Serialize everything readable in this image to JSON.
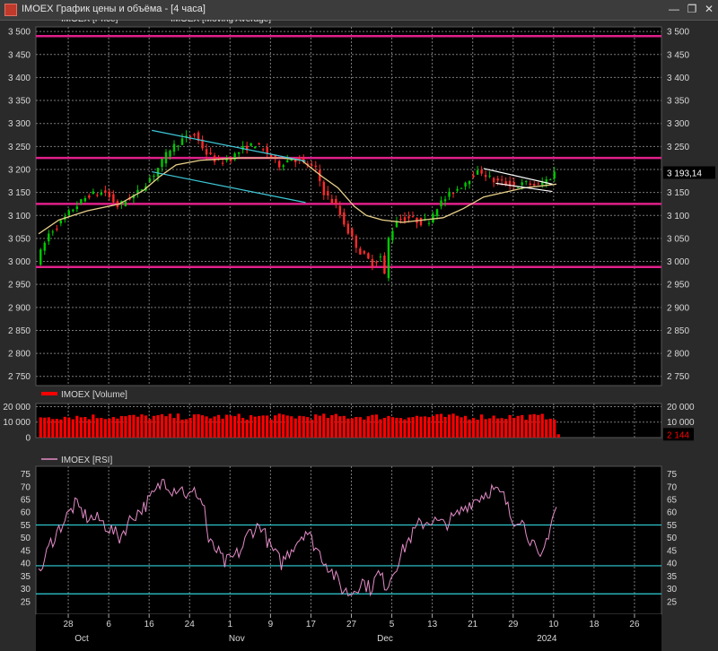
{
  "window": {
    "title": "IMOEX График цены и объёма - [4 часа]",
    "minimize_glyph": "—",
    "restore_glyph": "❐",
    "close_glyph": "✕"
  },
  "colors": {
    "background": "#2a2a2a",
    "plot_background": "#000000",
    "grid": "#7a7a7a",
    "bull_candle": "#00c800",
    "bear_candle": "#ff2a2a",
    "moving_average": "#e8d08a",
    "level_line": "#e0208a",
    "channel_line": "#3ec8d8",
    "flag_line": "#ffffff",
    "volume": "#ff0000",
    "rsi_line": "#e48cc8",
    "rsi_level": "#30d0d8",
    "last_price_label": "#000000"
  },
  "chart_data": [
    {
      "type": "candlestick",
      "panel": "price",
      "series": [
        {
          "name": "IMOEX [Price]",
          "legend_icon": "white-line"
        },
        {
          "name": "IMOEX [Moving Average]",
          "legend_icon": "tan-line"
        }
      ],
      "ylim": [
        2730,
        3510
      ],
      "y_ticks": [
        "3 500",
        "3 450",
        "3 400",
        "3 350",
        "3 300",
        "3 250",
        "3 200",
        "3 150",
        "3 100",
        "3 050",
        "3 000",
        "2 950",
        "2 900",
        "2 850",
        "2 800",
        "2 750"
      ],
      "y_tick_values": [
        3500,
        3450,
        3400,
        3350,
        3300,
        3250,
        3200,
        3150,
        3100,
        3050,
        3000,
        2950,
        2900,
        2850,
        2800,
        2750
      ],
      "last_price_label": "3 193,14",
      "last_price": 3193.14,
      "horizontal_levels": [
        3490,
        3225,
        3125,
        2988
      ],
      "price_path": [
        [
          0,
          3000
        ],
        [
          3,
          3060
        ],
        [
          6,
          3085
        ],
        [
          9,
          3115
        ],
        [
          13,
          3145
        ],
        [
          17,
          3150
        ],
        [
          20,
          3120
        ],
        [
          25,
          3150
        ],
        [
          29,
          3190
        ],
        [
          33,
          3245
        ],
        [
          36,
          3265
        ],
        [
          39,
          3275
        ],
        [
          42,
          3235
        ],
        [
          45,
          3215
        ],
        [
          48,
          3225
        ],
        [
          51,
          3245
        ],
        [
          54,
          3255
        ],
        [
          57,
          3235
        ],
        [
          60,
          3210
        ],
        [
          63,
          3225
        ],
        [
          66,
          3215
        ],
        [
          69,
          3200
        ],
        [
          71,
          3150
        ],
        [
          74,
          3120
        ],
        [
          77,
          3065
        ],
        [
          80,
          3020
        ],
        [
          83,
          2995
        ],
        [
          85,
          3010
        ],
        [
          86,
          2970
        ],
        [
          87,
          3050
        ],
        [
          89,
          3090
        ],
        [
          92,
          3095
        ],
        [
          95,
          3085
        ],
        [
          97,
          3090
        ],
        [
          99,
          3120
        ],
        [
          102,
          3145
        ],
        [
          105,
          3165
        ],
        [
          108,
          3190
        ],
        [
          110,
          3195
        ],
        [
          113,
          3175
        ],
        [
          116,
          3170
        ],
        [
          119,
          3165
        ],
        [
          121,
          3170
        ],
        [
          124,
          3165
        ],
        [
          127,
          3183
        ],
        [
          128,
          3193.14
        ]
      ],
      "ma_path": [
        [
          0,
          3060
        ],
        [
          5,
          3090
        ],
        [
          12,
          3110
        ],
        [
          20,
          3125
        ],
        [
          26,
          3155
        ],
        [
          30,
          3185
        ],
        [
          34,
          3210
        ],
        [
          40,
          3220
        ],
        [
          50,
          3225
        ],
        [
          60,
          3225
        ],
        [
          65,
          3220
        ],
        [
          70,
          3185
        ],
        [
          74,
          3160
        ],
        [
          78,
          3120
        ],
        [
          81,
          3100
        ],
        [
          85,
          3090
        ],
        [
          90,
          3085
        ],
        [
          95,
          3090
        ],
        [
          100,
          3095
        ],
        [
          105,
          3115
        ],
        [
          110,
          3140
        ],
        [
          115,
          3150
        ],
        [
          120,
          3160
        ],
        [
          125,
          3165
        ],
        [
          128,
          3168
        ]
      ],
      "trend_lines": [
        {
          "name": "channel-upper",
          "from": [
            28,
            3285
          ],
          "to": [
            66,
            3218
          ]
        },
        {
          "name": "channel-lower",
          "from": [
            28,
            3195
          ],
          "to": [
            66,
            3128
          ]
        },
        {
          "name": "flag-upper",
          "from": [
            110,
            3202
          ],
          "to": [
            127,
            3168
          ]
        },
        {
          "name": "flag-lower",
          "from": [
            113,
            3170
          ],
          "to": [
            127,
            3152
          ]
        }
      ]
    },
    {
      "type": "bar",
      "panel": "volume",
      "series": [
        {
          "name": "IMOEX [Volume]",
          "legend_icon": "red-bar"
        }
      ],
      "ylim": [
        0,
        22000
      ],
      "y_ticks_left": [
        "20 000",
        "10 000",
        "0"
      ],
      "y_ticks_right": [
        "20 000",
        "10 000"
      ],
      "y_tick_values": [
        20000,
        10000,
        0
      ],
      "last_value_label": "2 144",
      "typical_value": 13500,
      "last_value": 2144
    },
    {
      "type": "line",
      "panel": "rsi",
      "series": [
        {
          "name": "IMOEX [RSI]",
          "legend_icon": "pink-line"
        }
      ],
      "ylim": [
        20,
        78
      ],
      "y_ticks": [
        "75",
        "70",
        "65",
        "60",
        "55",
        "50",
        "45",
        "40",
        "35",
        "30",
        "25"
      ],
      "y_tick_values": [
        75,
        70,
        65,
        60,
        55,
        50,
        45,
        40,
        35,
        30,
        25
      ],
      "levels": [
        55,
        39,
        28
      ],
      "rsi_path": [
        [
          0,
          35
        ],
        [
          3,
          48
        ],
        [
          6,
          56
        ],
        [
          9,
          63
        ],
        [
          12,
          58
        ],
        [
          15,
          57
        ],
        [
          18,
          53
        ],
        [
          20,
          50
        ],
        [
          23,
          58
        ],
        [
          26,
          62
        ],
        [
          29,
          68
        ],
        [
          31,
          73
        ],
        [
          33,
          69
        ],
        [
          35,
          70
        ],
        [
          37,
          66
        ],
        [
          39,
          68
        ],
        [
          41,
          62
        ],
        [
          42,
          48
        ],
        [
          44,
          45
        ],
        [
          46,
          40
        ],
        [
          48,
          42
        ],
        [
          50,
          45
        ],
        [
          52,
          52
        ],
        [
          55,
          55
        ],
        [
          57,
          47
        ],
        [
          60,
          40
        ],
        [
          63,
          47
        ],
        [
          66,
          53
        ],
        [
          69,
          45
        ],
        [
          72,
          38
        ],
        [
          75,
          30
        ],
        [
          77,
          28
        ],
        [
          80,
          33
        ],
        [
          82,
          30
        ],
        [
          84,
          36
        ],
        [
          86,
          31
        ],
        [
          88,
          38
        ],
        [
          91,
          48
        ],
        [
          94,
          55
        ],
        [
          97,
          57
        ],
        [
          100,
          55
        ],
        [
          103,
          58
        ],
        [
          106,
          63
        ],
        [
          109,
          66
        ],
        [
          112,
          69
        ],
        [
          115,
          66
        ],
        [
          117,
          57
        ],
        [
          119,
          58
        ],
        [
          122,
          48
        ],
        [
          124,
          40
        ],
        [
          126,
          52
        ],
        [
          127,
          58
        ],
        [
          128,
          62
        ]
      ]
    }
  ],
  "x_axis": {
    "day_labels": [
      {
        "t": 4,
        "label": "28"
      },
      {
        "t": 10,
        "label": "6"
      },
      {
        "t": 16,
        "label": "16"
      },
      {
        "t": 22,
        "label": "24"
      },
      {
        "t": 28,
        "label": "1"
      },
      {
        "t": 34,
        "label": "9"
      },
      {
        "t": 40,
        "label": "17"
      },
      {
        "t": 46,
        "label": "27"
      },
      {
        "t": 52,
        "label": "5"
      },
      {
        "t": 58,
        "label": "13"
      },
      {
        "t": 64,
        "label": "21"
      },
      {
        "t": 70,
        "label": "29"
      },
      {
        "t": 76,
        "label": "10"
      },
      {
        "t": 82,
        "label": "18"
      },
      {
        "t": 88,
        "label": "26"
      }
    ],
    "month_labels": [
      {
        "t": 6,
        "label": "Oct"
      },
      {
        "t": 29,
        "label": "Nov"
      },
      {
        "t": 51,
        "label": "Dec"
      },
      {
        "t": 75,
        "label": "2024"
      }
    ],
    "n_slots": 92
  }
}
